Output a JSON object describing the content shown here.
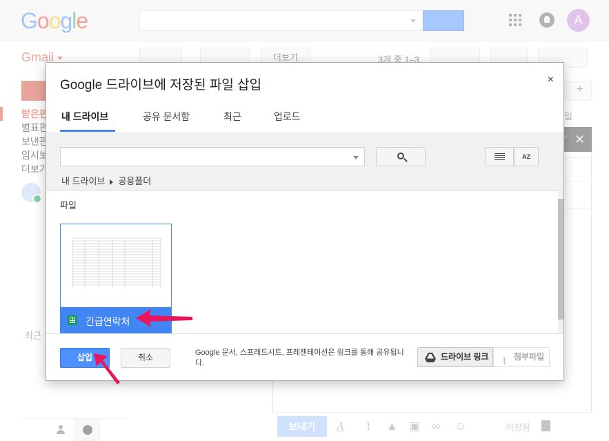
{
  "header": {
    "logo": [
      "G",
      "o",
      "o",
      "g",
      "l",
      "e"
    ],
    "logo_colors": [
      "#4285f4",
      "#ea4335",
      "#fbbc05",
      "#4285f4",
      "#34a853",
      "#ea4335"
    ],
    "avatar_letter": "A"
  },
  "gmail": {
    "label": "Gmail",
    "more_button": "더보기",
    "pagination": "3개 중 1–3",
    "nav_items": [
      "받은편",
      "별표편",
      "보낸편",
      "임시보",
      "더보기"
    ],
    "recent_label": "최근",
    "right_label": "일",
    "compose": {
      "send_label": "보내기",
      "saved_label": "저장됨"
    }
  },
  "dialog": {
    "title": "Google 드라이브에 저장된 파일 삽입",
    "close_symbol": "×",
    "tabs": [
      "내 드라이브",
      "공유 문서함",
      "최근",
      "업로드"
    ],
    "active_tab": 0,
    "search": {
      "value": "",
      "placeholder": ""
    },
    "sort_label": "AZ",
    "breadcrumb": [
      "내 드라이브",
      "공용폴더"
    ],
    "section_label": "파일",
    "files": [
      {
        "name": "긴급연락처",
        "type": "spreadsheet",
        "selected": true
      }
    ],
    "footer": {
      "insert_label": "삽입",
      "cancel_label": "취소",
      "note": "Google 문서, 스프레드시트, 프레젠테이션은 링크를 통해 공유됩니다.",
      "drive_link_label": "드라이브 링크",
      "attachment_label": "첨부파일"
    }
  },
  "colors": {
    "accent": "#4285f4",
    "insert_button": "#4d90fe",
    "gmail_red": "#dd4b39",
    "annotation_arrow": "#e8175d"
  }
}
